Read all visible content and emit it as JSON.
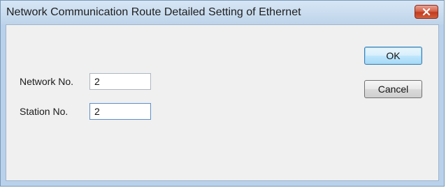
{
  "window": {
    "title": "Network Communication Route  Detailed Setting of Ethernet",
    "close_icon": "close-x-icon"
  },
  "form": {
    "network_no": {
      "label": "Network No.",
      "value": "2"
    },
    "station_no": {
      "label": "Station No.",
      "value": "2"
    }
  },
  "buttons": {
    "ok_label": "OK",
    "cancel_label": "Cancel"
  }
}
